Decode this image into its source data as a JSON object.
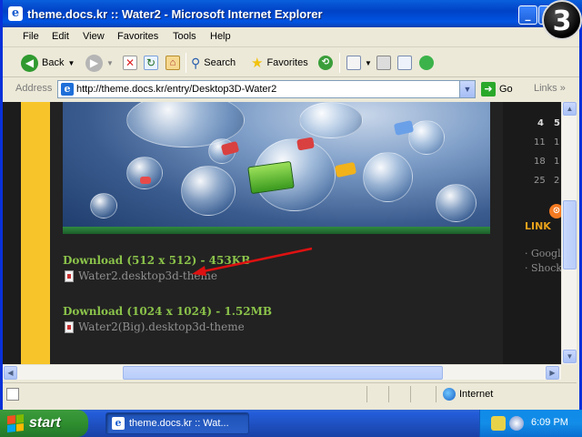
{
  "window": {
    "title": "theme.docs.kr :: Water2 - Microsoft Internet Explorer",
    "badge_number": "3"
  },
  "menu": [
    "File",
    "Edit",
    "View",
    "Favorites",
    "Tools",
    "Help"
  ],
  "toolbar": {
    "back": "Back",
    "search": "Search",
    "favorites": "Favorites"
  },
  "address": {
    "label": "Address",
    "url": "http://theme.docs.kr/entry/Desktop3D-Water2",
    "go": "Go",
    "links": "Links"
  },
  "content": {
    "download1": "Download (512 x 512) - 453KB",
    "file1": "Water2.desktop3d-theme",
    "download2": "Download (1024 x 1024) - 1.52MB",
    "file2": "Water2(Big).desktop3d-theme"
  },
  "sidebar": {
    "calendar": [
      [
        "4",
        "5"
      ],
      [
        "11",
        "1"
      ],
      [
        "18",
        "1"
      ],
      [
        "25",
        "2"
      ]
    ],
    "link_heading": "LINK",
    "links": [
      "Google",
      "Shock"
    ]
  },
  "status": {
    "zone": "Internet"
  },
  "taskbar": {
    "start": "start",
    "task_title": "theme.docs.kr :: Wat...",
    "clock": "6:09 PM"
  },
  "colors": {
    "title_blue": "#0054e3",
    "yellow_bar": "#f7c52a",
    "download_green": "#8bc34a",
    "link_orange": "#e8a21b",
    "arrow_red": "#dd1111"
  }
}
